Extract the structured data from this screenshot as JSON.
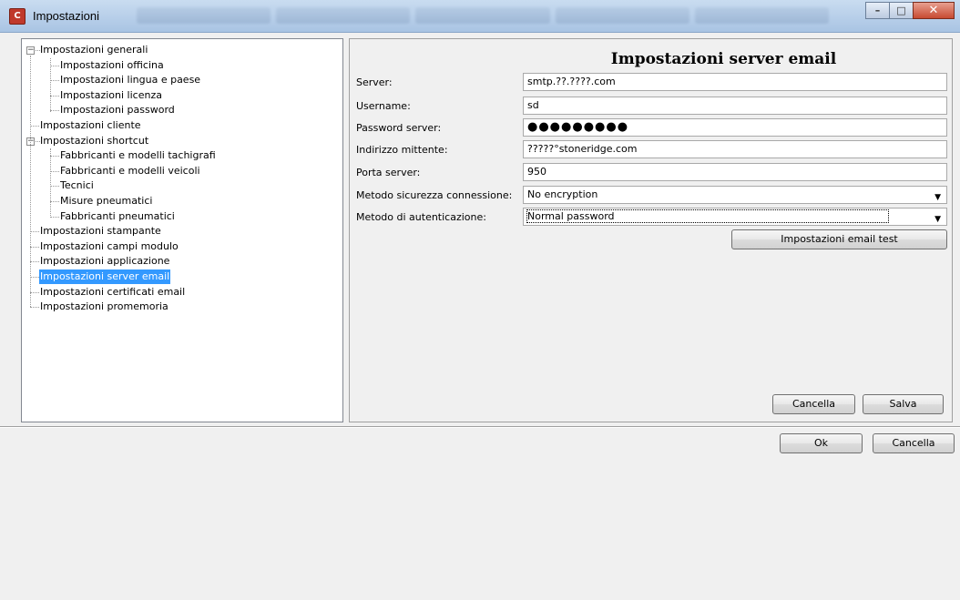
{
  "window": {
    "title": "Impostazioni",
    "app_icon_text": "C",
    "controls": {
      "minimize": "–",
      "maximize": "□",
      "close": "✕"
    }
  },
  "tree": {
    "items": [
      {
        "label": "Impostazioni generali",
        "level": 0,
        "expander": "−"
      },
      {
        "label": "Impostazioni officina",
        "level": 1
      },
      {
        "label": "Impostazioni lingua e paese",
        "level": 1
      },
      {
        "label": "Impostazioni licenza",
        "level": 1
      },
      {
        "label": "Impostazioni password",
        "level": 1
      },
      {
        "label": "Impostazioni cliente",
        "level": 0
      },
      {
        "label": "Impostazioni shortcut",
        "level": 0,
        "expander": "−"
      },
      {
        "label": "Fabbricanti e modelli tachigrafi",
        "level": 1
      },
      {
        "label": "Fabbricanti e modelli veicoli",
        "level": 1
      },
      {
        "label": "Tecnici",
        "level": 1
      },
      {
        "label": "Misure pneumatici",
        "level": 1
      },
      {
        "label": "Fabbricanti pneumatici",
        "level": 1
      },
      {
        "label": "Impostazioni stampante",
        "level": 0
      },
      {
        "label": "Impostazioni campi modulo",
        "level": 0
      },
      {
        "label": "Impostazioni applicazione",
        "level": 0
      },
      {
        "label": "Impostazioni server email",
        "level": 0,
        "selected": true
      },
      {
        "label": "Impostazioni certificati email",
        "level": 0
      },
      {
        "label": "Impostazioni promemoria",
        "level": 0
      }
    ],
    "selection_color": "#3399ff"
  },
  "panel": {
    "title": "Impostazioni server email",
    "fields": {
      "server": {
        "label": "Server:",
        "value": "smtp.??.????.com"
      },
      "username": {
        "label": "Username:",
        "value": "sd"
      },
      "password": {
        "label": "Password server:",
        "value": "●●●●●●●●●"
      },
      "sender": {
        "label": "Indirizzo mittente:",
        "value": "?????°stoneridge.com"
      },
      "port": {
        "label": "Porta server:",
        "value": "950"
      },
      "security": {
        "label": "Metodo sicurezza connessione:",
        "value": "No encryption"
      },
      "auth": {
        "label": "Metodo di autenticazione:",
        "value": "Normal password"
      }
    },
    "test_button": "Impostazioni email test",
    "cancel_button": "Cancella",
    "save_button": "Salva"
  },
  "footer": {
    "ok_button": "Ok",
    "cancel_button": "Cancella"
  }
}
